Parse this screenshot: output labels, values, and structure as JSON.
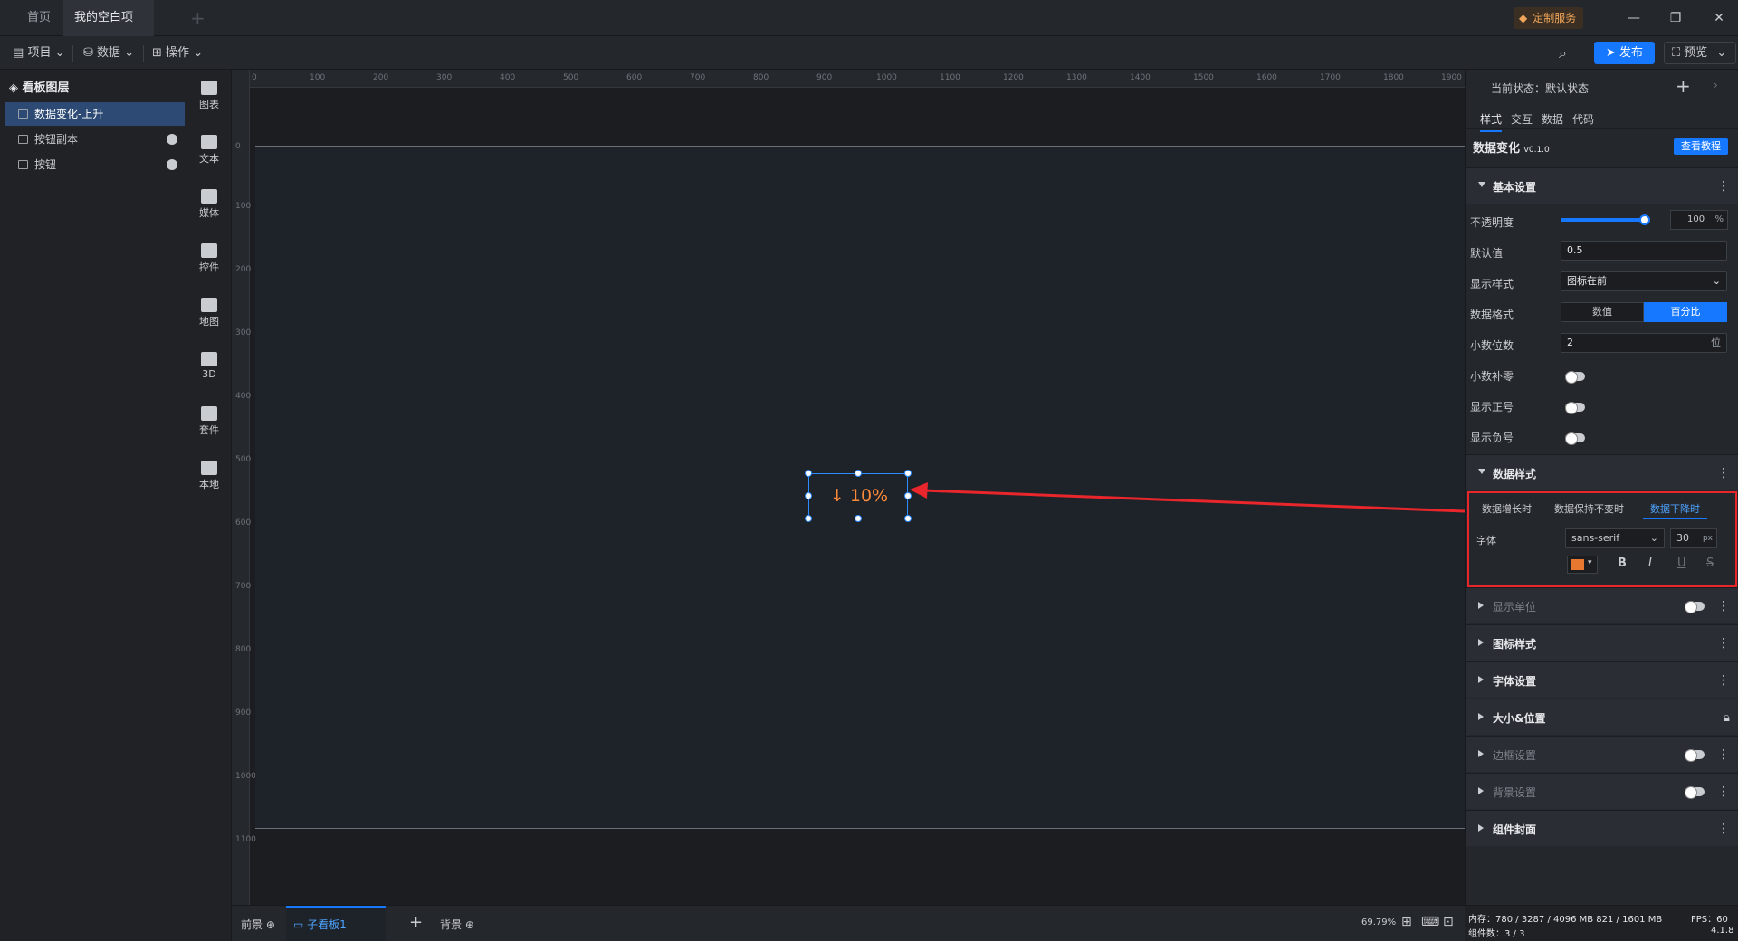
{
  "tabs": {
    "home": "首页",
    "project": "我的空白项目"
  },
  "titlebar": {
    "custom_service": "定制服务"
  },
  "toolbar": {
    "project": "项目",
    "data": "数据",
    "operation": "操作",
    "publish": "发布",
    "preview": "预览"
  },
  "layers": {
    "title": "看板图层",
    "items": [
      {
        "label": "数据变化-上升",
        "selected": true
      },
      {
        "label": "按钮副本",
        "selected": false
      },
      {
        "label": "按钮",
        "selected": false
      }
    ]
  },
  "categories": [
    "图表",
    "文本",
    "媒体",
    "控件",
    "地图",
    "3D",
    "套件",
    "本地"
  ],
  "ruler": {
    "top": [
      "0",
      "100",
      "200",
      "300",
      "400",
      "500",
      "600",
      "700",
      "800",
      "900",
      "1000",
      "1100",
      "1200",
      "1300",
      "1400",
      "1500",
      "1600",
      "1700",
      "1800",
      "1900"
    ],
    "left": [
      "0",
      "100",
      "200",
      "300",
      "400",
      "500",
      "600",
      "700",
      "800",
      "900",
      "1000",
      "1100"
    ]
  },
  "widget": {
    "arrow": "↓",
    "value": "10%"
  },
  "canvas_bottom": {
    "foreground": "前景",
    "sub_board": "子看板1",
    "background": "背景",
    "zoom": "69.79%"
  },
  "panel": {
    "state_label": "当前状态：默认状态",
    "tabs": [
      "样式",
      "交互",
      "数据",
      "代码"
    ],
    "component_name": "数据变化",
    "version": "v0.1.0",
    "tutorial": "查看教程",
    "basic": {
      "title": "基本设置",
      "opacity_label": "不透明度",
      "opacity_value": "100",
      "opacity_unit": "%",
      "default_label": "默认值",
      "default_value": "0.5",
      "display_label": "显示样式",
      "display_value": "图标在前",
      "format_label": "数据格式",
      "format_opt1": "数值",
      "format_opt2": "百分比",
      "decimals_label": "小数位数",
      "decimals_value": "2",
      "decimals_unit": "位",
      "pad_zero_label": "小数补零",
      "show_plus_label": "显示正号",
      "show_minus_label": "显示负号"
    },
    "data_style": {
      "title": "数据样式",
      "tab_up": "数据增长时",
      "tab_same": "数据保持不变时",
      "tab_down": "数据下降时",
      "font_label": "字体",
      "font_value": "sans-serif",
      "size_value": "30",
      "size_unit": "px",
      "bold": "B",
      "italic": "I",
      "underline": "U",
      "strike": "S",
      "color": "#e8782f"
    },
    "sections": [
      "显示单位",
      "图标样式",
      "字体设置",
      "大小&位置",
      "边框设置",
      "背景设置",
      "组件封面"
    ]
  },
  "status": {
    "memory": "内存：780 / 3287 / 4096 MB  821 / 1601 MB",
    "fps": "FPS：60",
    "components": "组件数：3 / 3",
    "version": "4.1.8"
  }
}
